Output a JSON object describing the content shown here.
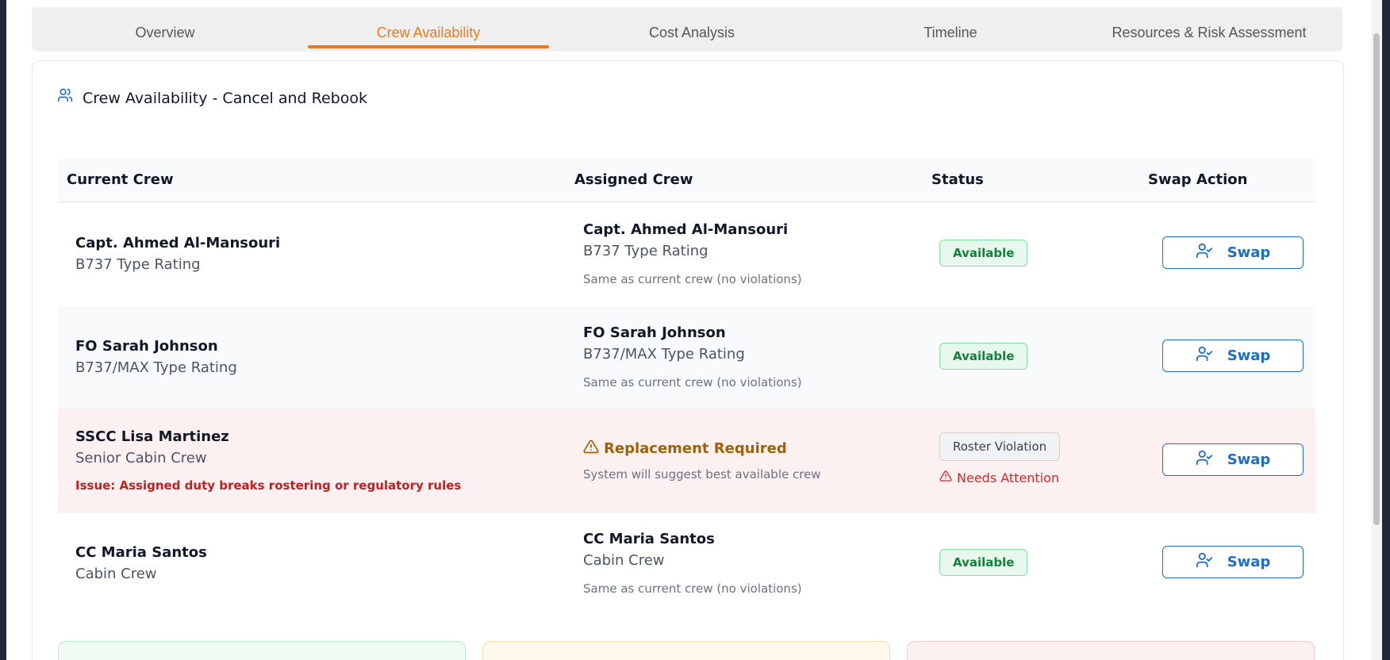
{
  "tabs": [
    {
      "label": "Overview"
    },
    {
      "label": "Crew Availability"
    },
    {
      "label": "Cost Analysis"
    },
    {
      "label": "Timeline"
    },
    {
      "label": "Resources & Risk Assessment"
    }
  ],
  "active_tab": "Crew Availability",
  "section": {
    "title": "Crew Availability - Cancel and Rebook"
  },
  "table": {
    "headers": [
      "Current Crew",
      "Assigned Crew",
      "Status",
      "Swap Action"
    ],
    "rows": [
      {
        "current_name": "Capt. Ahmed Al-Mansouri",
        "current_role": "B737 Type Rating",
        "assigned_name": "Capt. Ahmed Al-Mansouri",
        "assigned_role": "B737 Type Rating",
        "assigned_note": "Same as current crew (no violations)",
        "status": "Available",
        "action": "Swap"
      },
      {
        "current_name": "FO Sarah Johnson",
        "current_role": "B737/MAX Type Rating",
        "assigned_name": "FO Sarah Johnson",
        "assigned_role": "B737/MAX Type Rating",
        "assigned_note": "Same as current crew (no violations)",
        "status": "Available",
        "action": "Swap"
      },
      {
        "current_name": "SSCC Lisa Martinez",
        "current_role": "Senior Cabin Crew",
        "current_issue": "Issue: Assigned duty breaks rostering or regulatory rules",
        "assigned_title": "Replacement Required",
        "assigned_note": "System will suggest best available crew",
        "status": "Roster Violation",
        "status_note": "Needs Attention",
        "action": "Swap"
      },
      {
        "current_name": "CC Maria Santos",
        "current_role": "Cabin Crew",
        "assigned_name": "CC Maria Santos",
        "assigned_role": "Cabin Crew",
        "assigned_note": "Same as current crew (no violations)",
        "status": "Available",
        "action": "Swap"
      }
    ]
  },
  "colors": {
    "accent": "#f07a1a",
    "primary": "#1d6fc6",
    "success": "#15803d",
    "danger": "#dc2626",
    "warning": "#a16207"
  },
  "icons": {
    "section": "users-icon",
    "swap": "user-check-icon",
    "warning": "alert-triangle-icon"
  }
}
